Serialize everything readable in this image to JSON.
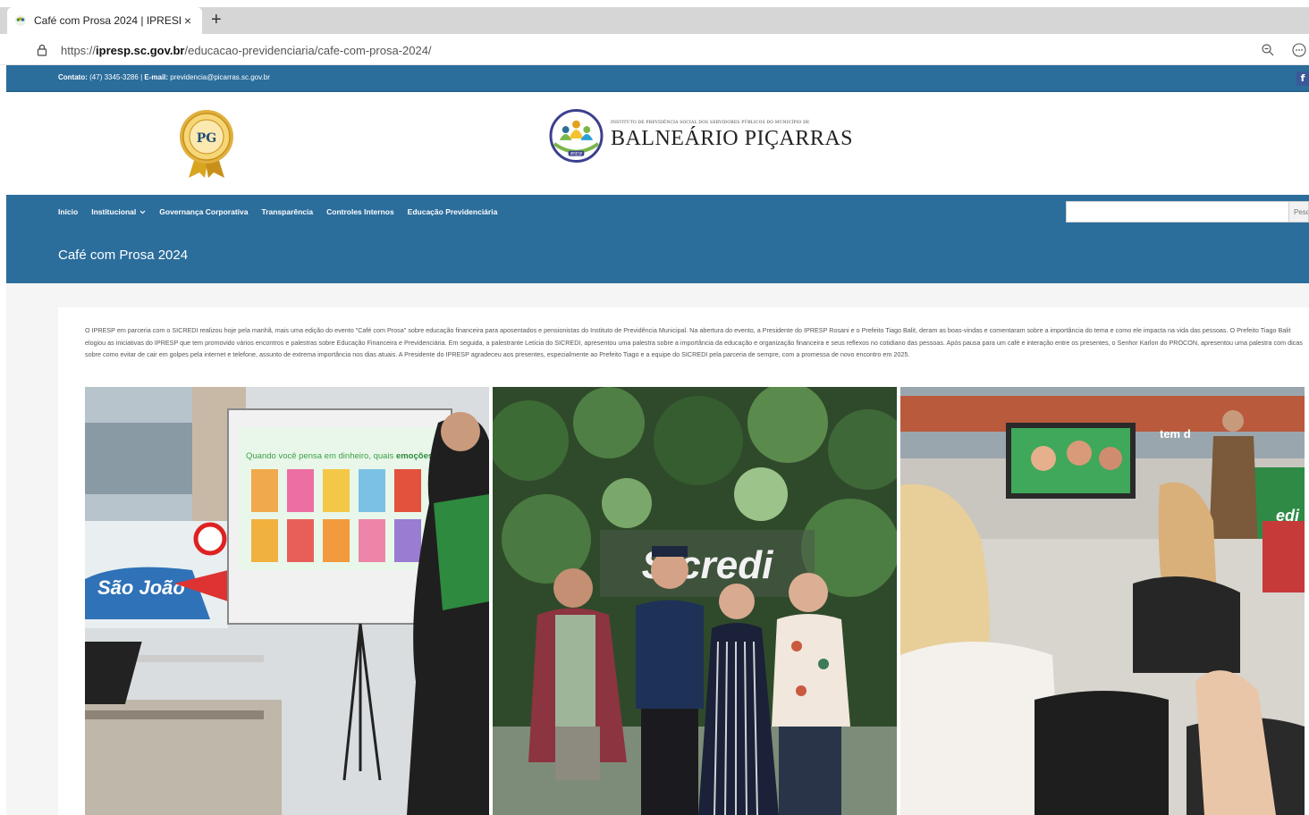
{
  "browser": {
    "tab_title": "Café com Prosa 2024 | IPRESP",
    "tab_close": "×",
    "new_tab": "+",
    "url_scheme": "https://",
    "url_domain": "ipresp.sc.gov.br",
    "url_path": "/educacao-previdenciaria/cafe-com-prosa-2024/"
  },
  "topbar": {
    "contact_label": "Contato:",
    "contact_phone": "(47) 3345-3286",
    "separator": "|",
    "email_label": "E-mail:",
    "email": "previdencia@picarras.sc.gov.br",
    "facebook_glyph": "f"
  },
  "header": {
    "institute_line": "INSTITUTO DE PREVIDÊNCIA SOCIAL DOS SERVIDORES PÚBLICOS DO MUNICÍPIO DE",
    "city_name": "BALNEÁRIO PIÇARRAS",
    "badge_letters": "PG",
    "logo_caption": "IPRESP"
  },
  "nav": {
    "items": [
      "Início",
      "Institucional",
      "Governança Corporativa",
      "Transparência",
      "Controles Internos",
      "Educação Previdenciária"
    ],
    "search_button": "Pesquisar"
  },
  "page": {
    "title": "Café com Prosa 2024",
    "article": "O IPRESP em parceria com o SICREDI realizou hoje pela manhã, mais uma edição do evento \"Café com Prosa\" sobre educação financeira para aposentados e pensionistas do Instituto de Previdência Municipal. Na abertura do evento, a Presidente do IPRESP Rosani e o Prefeito Tiago Balit, deram as boas-vindas e comentaram sobre a importância do tema e como ele impacta na vida das pessoas. O Prefeito Tiago Balit elogiou as iniciativas do IPRESP que tem promovido vários encontros e palestras sobre Educação Financeira e Previdenciária. Em seguida, a palestrante Letícia do SICREDI, apresentou uma palestra sobre a importância da educação e organização financeira e seus reflexos no cotidiano das pessoas. Após pausa para um café e interação entre os presentes, o Senhor Karlon do PROCON, apresentou uma palestra com dicas sobre como evitar de cair em golpes pela internet e telefone, assunto de extrema importância nos dias atuais. A Presidente do IPRESP agradeceu aos presentes, especialmente ao Prefeito Tiago e a equipe do SICREDI pela parceria de sempre, com a promessa de novo encontro em 2025."
  },
  "photos": {
    "slide_heading": "Quando você pensa em dinheiro, quais ",
    "slide_heading_emph": "emoções",
    "store_sign": "São João",
    "sicredi_wall": "Sicredi",
    "store_sign_right": "tem d",
    "green_sign": "edi"
  },
  "colors": {
    "brand_blue": "#2b6d9b",
    "page_bg": "#f5f5f5"
  }
}
